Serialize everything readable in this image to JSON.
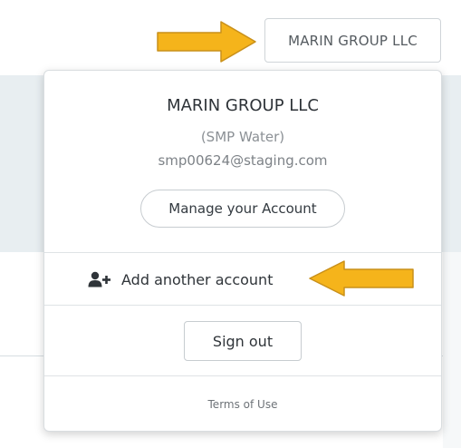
{
  "header": {
    "account_chip_label": "MARIN GROUP LLC"
  },
  "popover": {
    "account_name": "MARIN GROUP LLC",
    "account_org": "(SMP Water)",
    "account_email": "smp00624@staging.com",
    "manage_account_label": "Manage your Account",
    "add_account_label": "Add another account",
    "add_account_icon": "add-user-icon",
    "sign_out_label": "Sign out",
    "terms_label": "Terms of Use"
  },
  "annotations": {
    "arrow_color": "#f5b41b",
    "arrow_outline": "#c9901a"
  }
}
